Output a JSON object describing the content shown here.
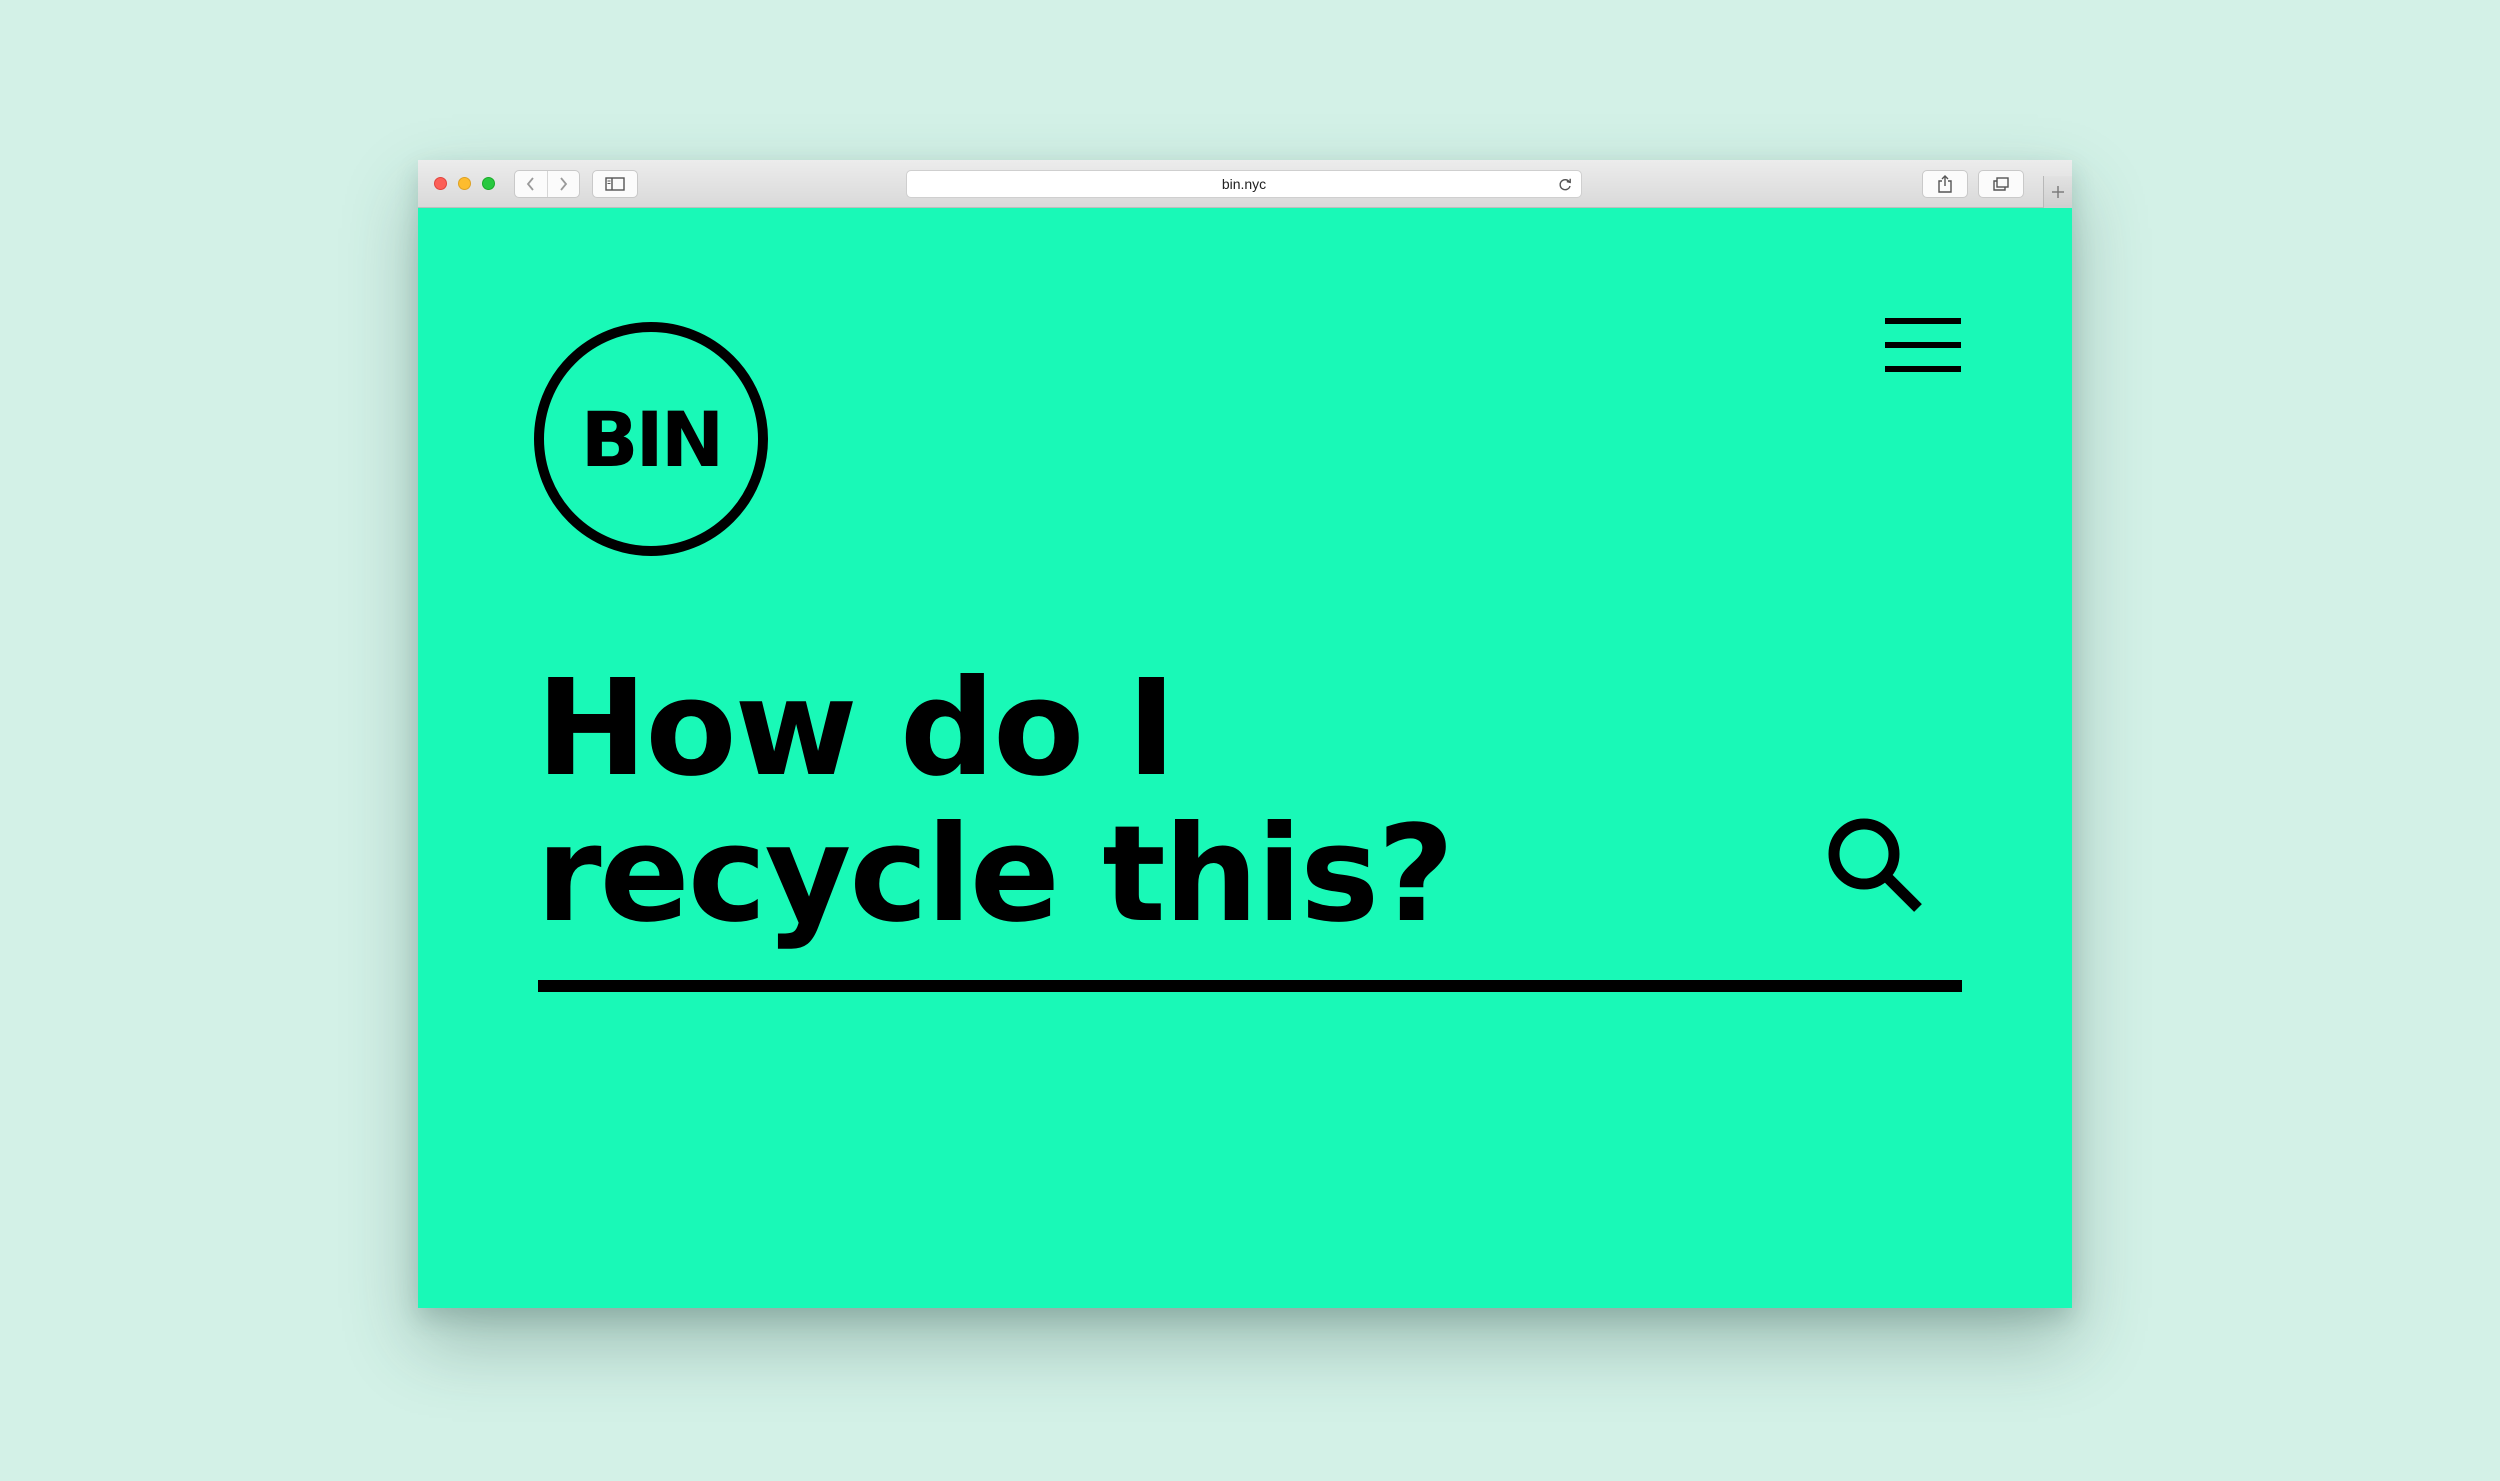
{
  "browser": {
    "url": "bin.nyc",
    "icons": {
      "back": "chevron-left-icon",
      "forward": "chevron-right-icon",
      "sidebar": "sidebar-icon",
      "reload": "reload-icon",
      "share": "share-icon",
      "tabs": "tabs-overview-icon",
      "new_tab": "plus-icon"
    }
  },
  "page": {
    "logo_text": "BIN",
    "menu_icon": "hamburger-menu-icon",
    "headline": {
      "line1": "How do I",
      "line2": "recycle this?"
    },
    "search_icon": "search-icon",
    "colors": {
      "background": "#19f9b7",
      "ink": "#000000",
      "outer": "#d3f1e7"
    }
  }
}
